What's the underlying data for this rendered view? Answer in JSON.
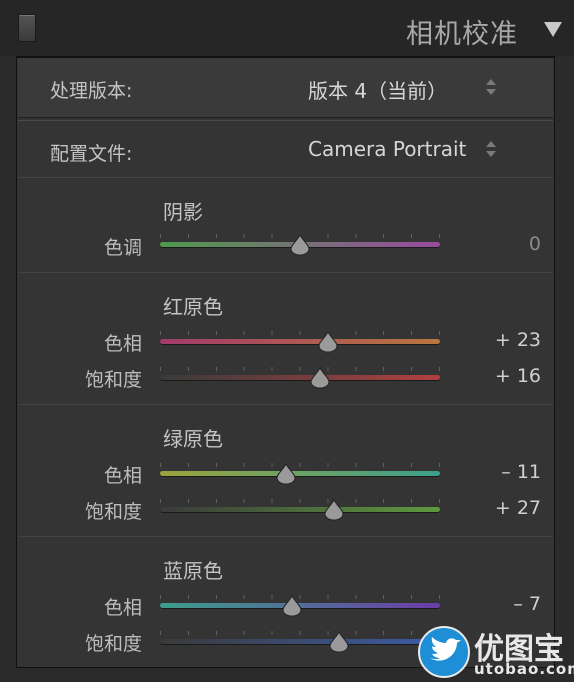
{
  "panel": {
    "title": "相机校准"
  },
  "process": {
    "label": "处理版本:",
    "value": "版本 4（当前）"
  },
  "profile": {
    "label": "配置文件:",
    "value": "Camera Portrait"
  },
  "shadows": {
    "title": "阴影",
    "tint": {
      "label": "色调",
      "value": "0",
      "level": 0.5
    }
  },
  "red_primary": {
    "title": "红原色",
    "hue": {
      "label": "色相",
      "value": "+ 23",
      "level": 0.6
    },
    "saturation": {
      "label": "饱和度",
      "value": "+ 16",
      "level": 0.57
    }
  },
  "green_primary": {
    "title": "绿原色",
    "hue": {
      "label": "色相",
      "value": "– 11",
      "level": 0.45
    },
    "saturation": {
      "label": "饱和度",
      "value": "+ 27",
      "level": 0.62
    }
  },
  "blue_primary": {
    "title": "蓝原色",
    "hue": {
      "label": "色相",
      "value": "– 7",
      "level": 0.47
    },
    "saturation": {
      "label": "饱和度",
      "value": "",
      "level": 0.64
    }
  },
  "watermark": {
    "brand": "优图宝",
    "url": "utobao.com"
  },
  "colors": {
    "tint_track": [
      "#4f9a4c",
      "#9a4a9e"
    ],
    "red_hue_track": [
      "#a33a6a",
      "#b8763c"
    ],
    "red_sat_track": [
      "#3a3a3a",
      "#b04040"
    ],
    "green_hue_track": [
      "#9aa33c",
      "#3ca08e"
    ],
    "green_sat_track": [
      "#3a3a3a",
      "#5e9a3e"
    ],
    "blue_hue_track": [
      "#3c9e8a",
      "#6a3ca8"
    ],
    "blue_sat_track": [
      "#3a3a3a",
      "#3c5ca8"
    ]
  },
  "icons": {
    "panel_toggle": "switch-icon",
    "collapse": "triangle-down-icon",
    "stepper": "up-down-arrows-icon"
  }
}
